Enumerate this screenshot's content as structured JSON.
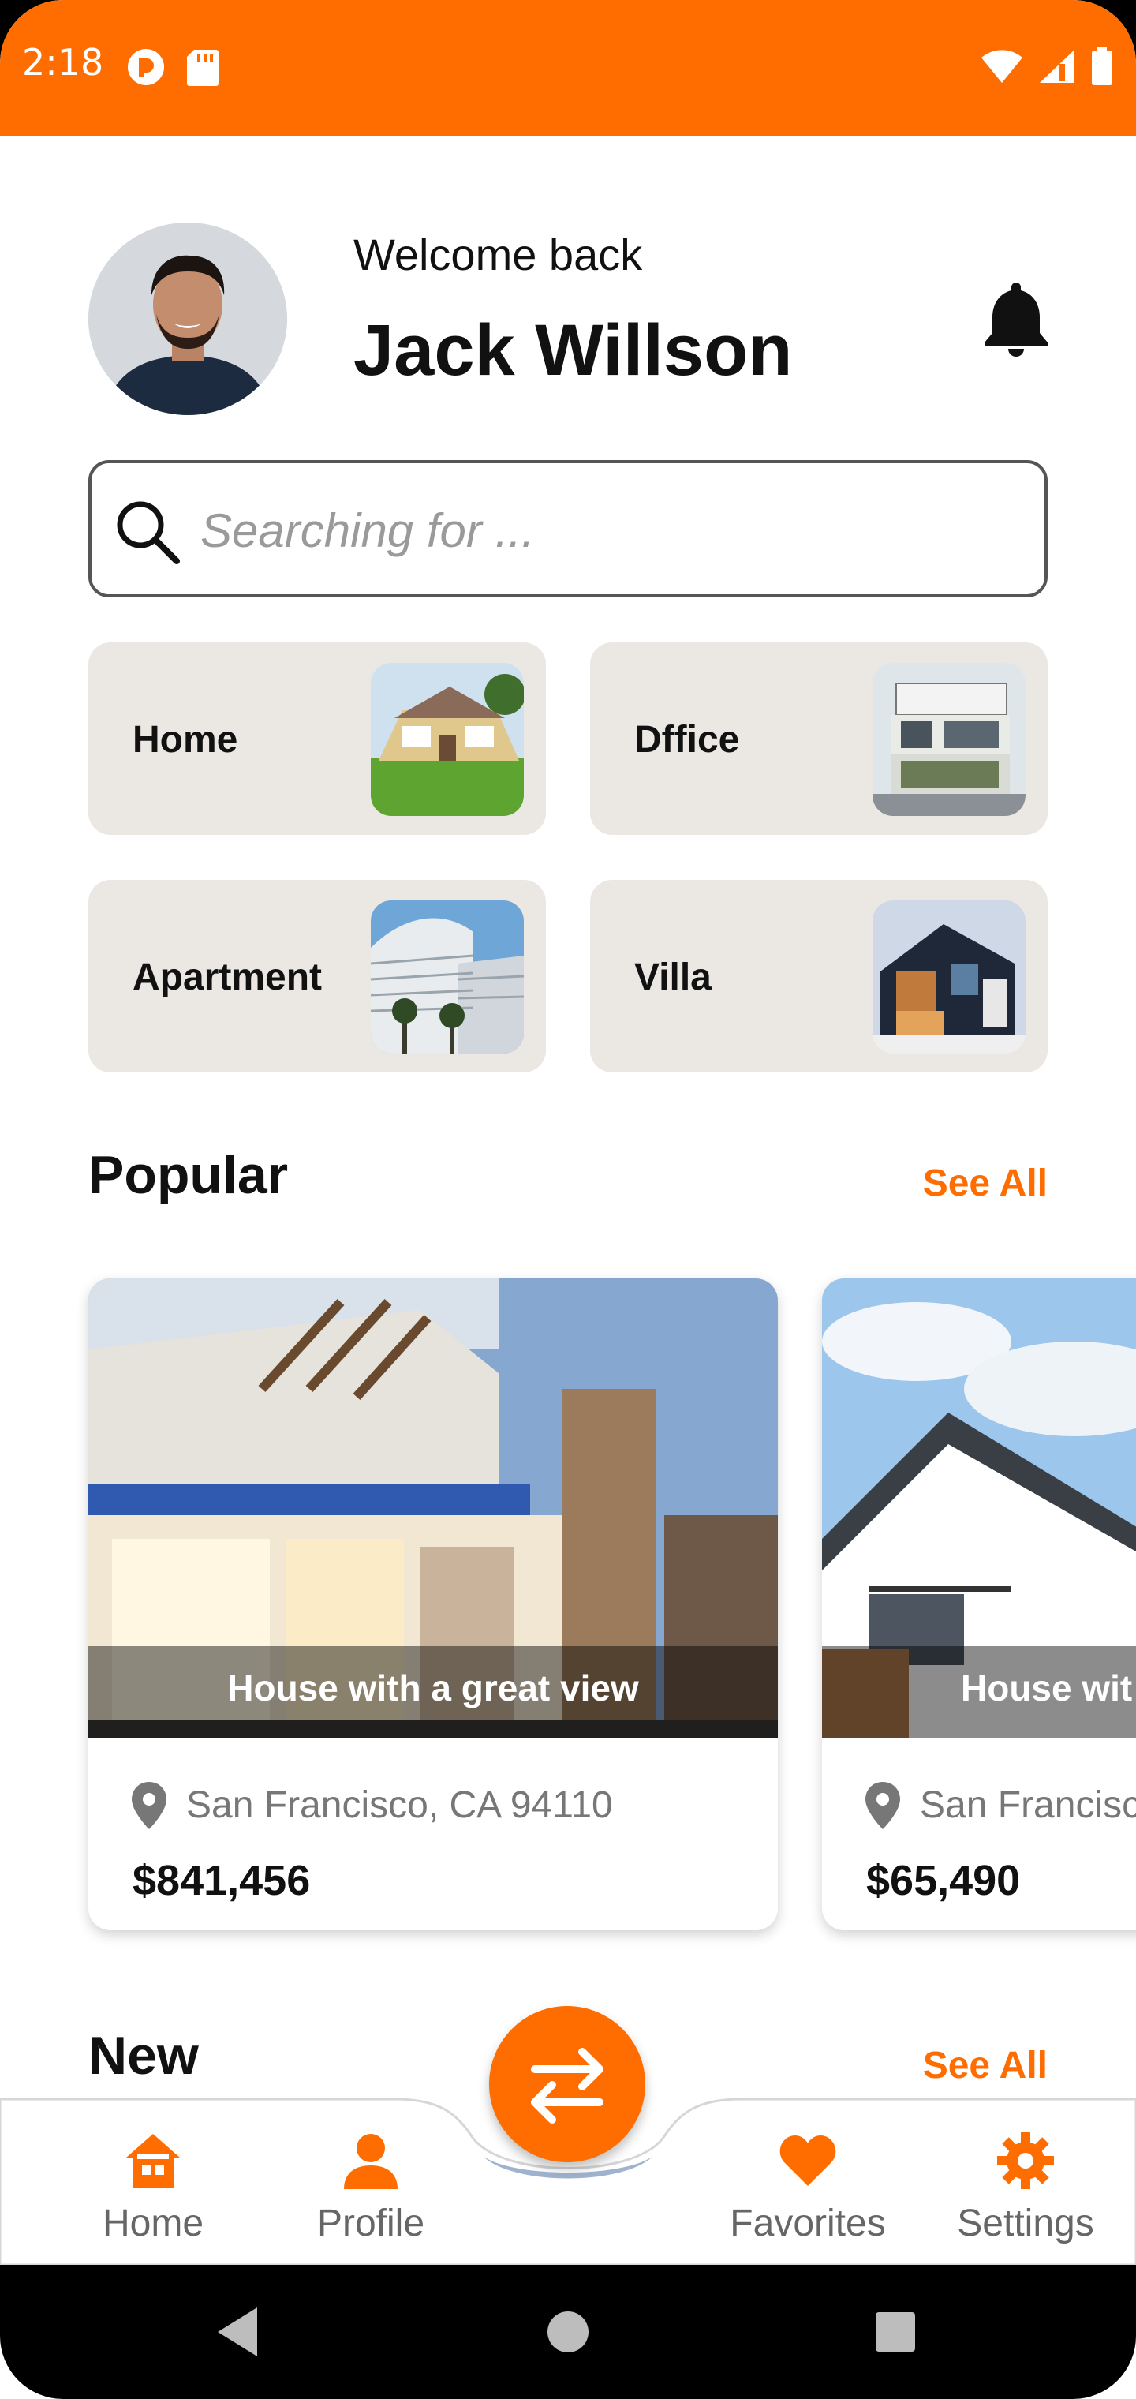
{
  "status_bar": {
    "time": "2:18",
    "icons_left": [
      "notification-app-icon",
      "sd-card-icon"
    ],
    "icons_right": [
      "wifi-icon",
      "signal-icon",
      "battery-icon"
    ],
    "color": "#FF6D00"
  },
  "header": {
    "welcome": "Welcome back",
    "name": "Jack Willson",
    "avatar_icon": "user-avatar",
    "bell_icon": "bell-icon"
  },
  "search": {
    "placeholder": "Searching for ...",
    "value": ""
  },
  "categories": [
    {
      "label": "Home",
      "image": "house-photo"
    },
    {
      "label": "Dffice",
      "image": "office-building-photo"
    },
    {
      "label": "Apartment",
      "image": "apartment-building-photo"
    },
    {
      "label": "Villa",
      "image": "villa-photo"
    }
  ],
  "popular": {
    "title": "Popular",
    "see_all": "See All",
    "cards": [
      {
        "caption": "House with a great view",
        "location": "San Francisco, CA 94110",
        "price": "$841,456"
      },
      {
        "caption": "House wit",
        "location": "San Francisco",
        "price": "$65,490"
      }
    ]
  },
  "new_section": {
    "title": "New",
    "see_all": "See All"
  },
  "bottom_nav": {
    "items": [
      {
        "label": "Home",
        "icon": "home-icon",
        "active": true
      },
      {
        "label": "Profile",
        "icon": "person-icon",
        "active": true
      },
      {
        "label": "Favorites",
        "icon": "heart-icon",
        "active": true
      },
      {
        "label": "Settings",
        "icon": "gear-icon",
        "active": true
      }
    ],
    "fab_icon": "swap-arrows-icon"
  },
  "system_nav": [
    "back-icon",
    "home-circle-icon",
    "recents-icon"
  ],
  "colors": {
    "accent": "#FF6D00",
    "category_bg": "#EBE7E3",
    "text": "#111111",
    "muted": "#777777"
  }
}
